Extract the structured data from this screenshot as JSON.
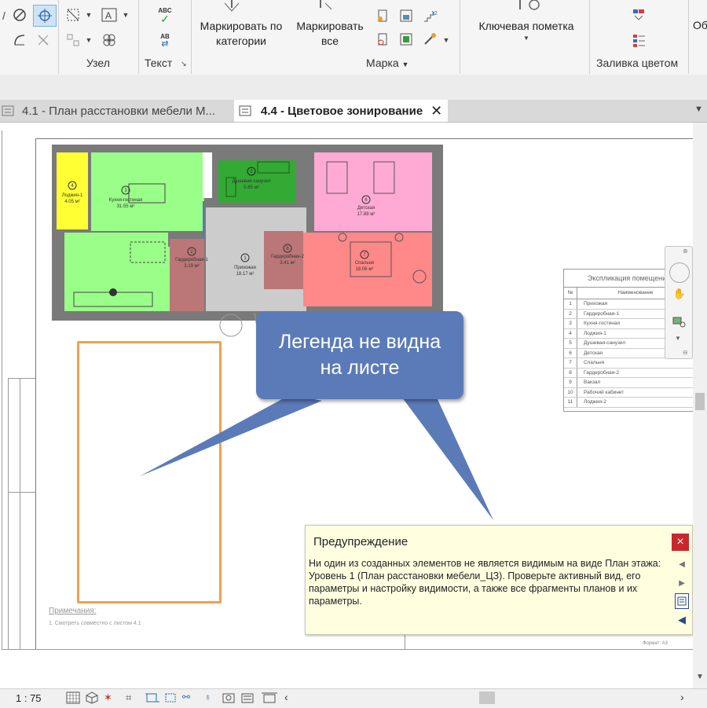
{
  "ribbon": {
    "group_node": "Узел",
    "group_text": "Текст",
    "group_tag": "Марка",
    "group_fill": "Заливка цветом",
    "tag_by_category_l1": "Маркировать по",
    "tag_by_category_l2": "категории",
    "tag_all_l1": "Маркировать",
    "tag_all_l2": "все",
    "keynote": "Ключевая пометка",
    "cut_label": "Об",
    "spell_label": "ABC",
    "find_label": "AB"
  },
  "tabs": [
    {
      "label": "4.1 - План расстановки мебели М..."
    },
    {
      "label": "4.4 - Цветовое зонирование"
    }
  ],
  "plan": {
    "rooms": [
      {
        "num": "4",
        "name": "Лоджия-1",
        "area": "4.05 м²",
        "color": "#ffff33"
      },
      {
        "num": "3",
        "name": "Кухня-гостиная",
        "area": "31.55 м²",
        "color": "#99ff88"
      },
      {
        "num": "5",
        "name": "Душевая-санузел",
        "area": "5.65 м²",
        "color": "#33aa33"
      },
      {
        "num": "6",
        "name": "Детская",
        "area": "17.88 м²",
        "color": "#ffaad4"
      },
      {
        "num": "2",
        "name": "Гардеробная-1",
        "area": "3.19 м²",
        "color": "#bb7777"
      },
      {
        "num": "1",
        "name": "Прихожая",
        "area": "18.17 м²",
        "color": "#cccccc"
      },
      {
        "num": "8",
        "name": "Гардеробная-2",
        "area": "3.41 м²",
        "color": "#bb7777"
      },
      {
        "num": "7",
        "name": "Спальня",
        "area": "18.06 м²",
        "color": "#ff8888"
      }
    ]
  },
  "schedule": {
    "title": "Экспликация помещений",
    "col_num": "№",
    "col_name": "Наименование",
    "rows": [
      {
        "n": "1",
        "name": "Прихожая"
      },
      {
        "n": "2",
        "name": "Гардеробная-1"
      },
      {
        "n": "3",
        "name": "Кухня-гостиная"
      },
      {
        "n": "4",
        "name": "Лоджия-1"
      },
      {
        "n": "5",
        "name": "Душевая-санузел"
      },
      {
        "n": "6",
        "name": "Детская"
      },
      {
        "n": "7",
        "name": "Спальня"
      },
      {
        "n": "8",
        "name": "Гардеробная-2"
      },
      {
        "n": "9",
        "name": "Вакзал"
      },
      {
        "n": "10",
        "name": "Рабочий кабинет"
      },
      {
        "n": "11",
        "name": "Лоджия-2"
      }
    ]
  },
  "notes": {
    "title": "Примечания:",
    "item": "1.  Смотреть совместно с листом 4.1"
  },
  "format_label": "Формат: А3",
  "callout": {
    "line1": "Легенда не видна",
    "line2": "на листе"
  },
  "warning": {
    "title": "Предупреждение",
    "body": "Ни один из созданных элементов не является видимым на виде План этажа: Уровень 1 (План расстановки мебели_ЦЗ). Проверьте активный вид, его параметры и настройку видимости, а также все фрагменты планов и их параметры.",
    "close": "×"
  },
  "status": {
    "scale": "1 : 75"
  },
  "colors": {
    "accent_orange": "#f0a050",
    "callout_blue": "#5b7bb8",
    "warning_bg": "#ffffe0",
    "close_red": "#c8282b"
  }
}
